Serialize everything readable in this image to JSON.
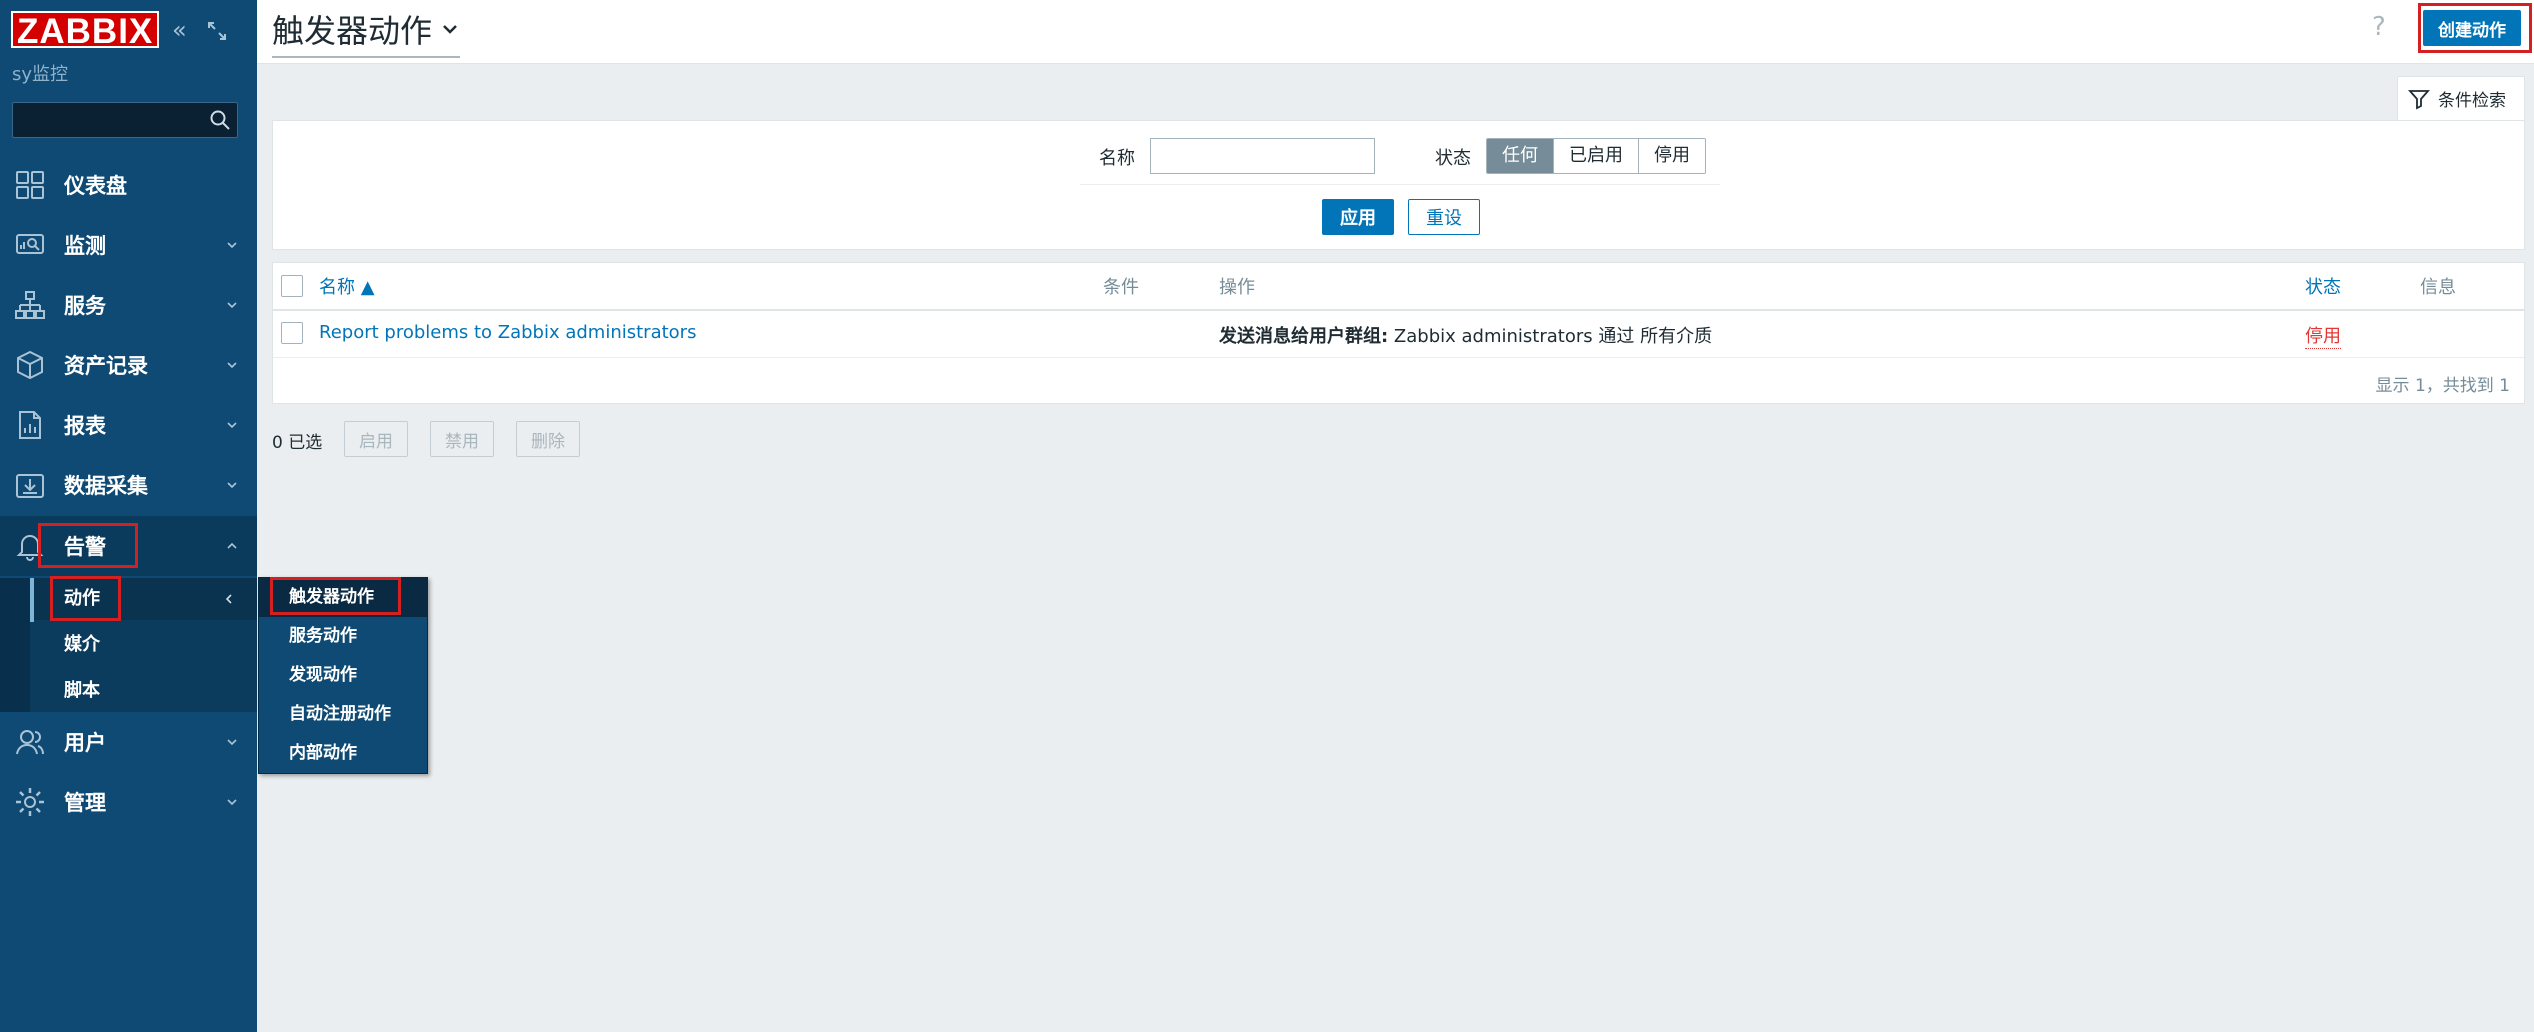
{
  "sidebar": {
    "logo": "ZABBIX",
    "host": "sy监控",
    "search_placeholder": "",
    "items": [
      {
        "label": "仪表盘",
        "icon": "dashboard-icon"
      },
      {
        "label": "监测",
        "icon": "monitoring-icon"
      },
      {
        "label": "服务",
        "icon": "services-icon"
      },
      {
        "label": "资产记录",
        "icon": "inventory-icon"
      },
      {
        "label": "报表",
        "icon": "reports-icon"
      },
      {
        "label": "数据采集",
        "icon": "data-collection-icon"
      },
      {
        "label": "告警",
        "icon": "alerts-icon"
      },
      {
        "label": "用户",
        "icon": "users-icon"
      },
      {
        "label": "管理",
        "icon": "administration-icon"
      }
    ],
    "alerts_submenu": [
      "动作",
      "媒介",
      "脚本"
    ],
    "actions_flyout": [
      "触发器动作",
      "服务动作",
      "发现动作",
      "自动注册动作",
      "内部动作"
    ]
  },
  "header": {
    "title": "触发器动作",
    "help": "?",
    "create_button": "创建动作"
  },
  "filter": {
    "tab_label": "条件检索",
    "name_label": "名称",
    "name_value": "",
    "status_label": "状态",
    "status_options": [
      "任何",
      "已启用",
      "停用"
    ],
    "status_selected": "任何",
    "apply": "应用",
    "reset": "重设"
  },
  "table": {
    "columns": {
      "name": "名称 ▲",
      "conditions": "条件",
      "operations": "操作",
      "status": "状态",
      "info": "信息"
    },
    "rows": [
      {
        "name": "Report problems to Zabbix administrators",
        "conditions": "",
        "operations_bold": "发送消息给用户群组:",
        "operations_rest": " Zabbix administrators 通过 所有介质",
        "status": "停用",
        "info": ""
      }
    ],
    "paging": "显示 1，共找到 1"
  },
  "footer": {
    "selected": "0 已选",
    "enable": "启用",
    "disable": "禁用",
    "delete": "删除"
  },
  "colors": {
    "sidebar": "#0e4a73",
    "primary": "#0275b8",
    "logo_red": "#d40000",
    "status_disabled": "#e33734",
    "highlight_red": "#d42020"
  }
}
